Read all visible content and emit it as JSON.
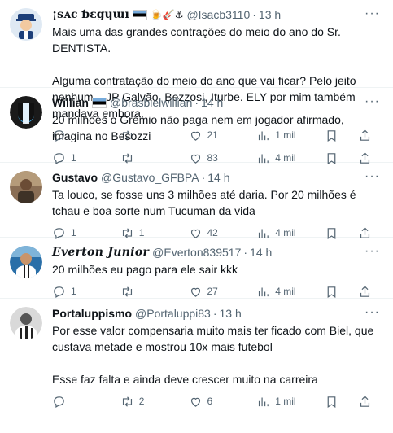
{
  "tweets": [
    {
      "name": "¡sᴀc ƅɛgɥɯı",
      "handle": "@Isacb3110",
      "time": "13 h",
      "text": "Mais uma das grandes contrações do meio do ano do Sr. DENTISTA.\n\nAlguma contratação do meio do ano que vai ficar? Pelo jeito nenhum... JP Galvão, Bezzosi, Iturbe. ELY por mim também mandava embora.",
      "replies": "",
      "retweets": "",
      "likes": "21",
      "views": "1 mil",
      "avatar": "sailor-avatar"
    },
    {
      "name": "Willian",
      "handle": "@brasbielwillian",
      "time": "14 h",
      "text": "20 milhões o Grêmio não paga nem em jogador afirmado, imagina no Besozzi",
      "replies": "1",
      "retweets": "",
      "likes": "83",
      "views": "4 mil",
      "avatar": "gremio-crest-avatar"
    },
    {
      "name": "Gustavo",
      "handle": "@Gustavo_GFBPA",
      "time": "14 h",
      "text": "Ta louco, se fosse uns 3 milhões até daria. Por 20 milhões é tchau e boa sorte num Tucuman da vida",
      "replies": "1",
      "retweets": "1",
      "likes": "42",
      "views": "4 mil",
      "avatar": "photo-avatar"
    },
    {
      "name": "Everton Junior",
      "handle": "@Everton839517",
      "time": "14 h",
      "text": "20 milhões eu pago para ele sair kkk",
      "replies": "1",
      "retweets": "",
      "likes": "27",
      "views": "4 mil",
      "avatar": "player-avatar"
    },
    {
      "name": "Portaluppismo",
      "handle": "@Portaluppi83",
      "time": "13 h",
      "text": "Por esse valor compensaria muito mais ter ficado com Biel, que custava metade e mostrou 10x mais futebol\n\nEsse faz falta e ainda deve crescer muito na carreira",
      "replies": "",
      "retweets": "2",
      "likes": "6",
      "views": "1 mil",
      "avatar": "portaluppi-avatar"
    }
  ],
  "icons": {
    "more": "more-icon",
    "reply": "reply-icon",
    "retweet": "retweet-icon",
    "like": "heart-icon",
    "views": "views-icon",
    "bookmark": "bookmark-icon",
    "share": "share-icon"
  },
  "colors": {
    "text": "#0f1419",
    "secondary": "#536471",
    "divider": "#eff3f4"
  }
}
